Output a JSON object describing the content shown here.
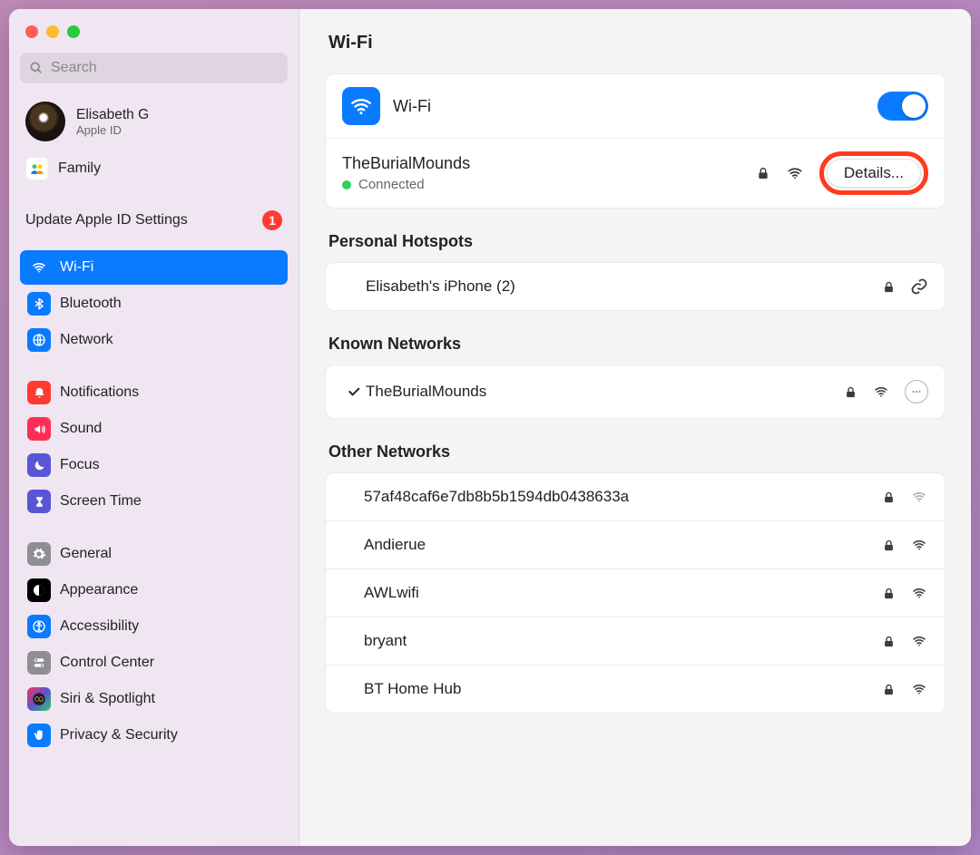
{
  "page_title": "Wi-Fi",
  "search": {
    "placeholder": "Search"
  },
  "user": {
    "name": "Elisabeth G",
    "subtitle": "Apple ID"
  },
  "family_label": "Family",
  "update_row": {
    "label": "Update Apple ID Settings",
    "badge": "1"
  },
  "sidebar": {
    "groups": [
      [
        {
          "id": "wifi",
          "label": "Wi-Fi",
          "selected": true,
          "icon": "wifi-icon",
          "tile": "#0a7aff"
        },
        {
          "id": "bluetooth",
          "label": "Bluetooth",
          "icon": "bluetooth-icon",
          "tile": "#0a7aff"
        },
        {
          "id": "network",
          "label": "Network",
          "icon": "globe-icon",
          "tile": "#0a7aff"
        }
      ],
      [
        {
          "id": "notifications",
          "label": "Notifications",
          "icon": "bell-icon",
          "tile": "#ff3b30"
        },
        {
          "id": "sound",
          "label": "Sound",
          "icon": "speaker-icon",
          "tile": "#ff2d55"
        },
        {
          "id": "focus",
          "label": "Focus",
          "icon": "moon-icon",
          "tile": "#5856d6"
        },
        {
          "id": "screen-time",
          "label": "Screen Time",
          "icon": "hourglass-icon",
          "tile": "#5856d6"
        }
      ],
      [
        {
          "id": "general",
          "label": "General",
          "icon": "gear-icon",
          "tile": "#8e8e93"
        },
        {
          "id": "appearance",
          "label": "Appearance",
          "icon": "appearance-icon",
          "tile": "#000000"
        },
        {
          "id": "accessibility",
          "label": "Accessibility",
          "icon": "accessibility-icon",
          "tile": "#0a7aff"
        },
        {
          "id": "control-center",
          "label": "Control Center",
          "icon": "switches-icon",
          "tile": "#8e8e93"
        },
        {
          "id": "siri",
          "label": "Siri & Spotlight",
          "icon": "siri-icon",
          "tile": "linear-gradient(135deg,#ff2d55,#5856d6,#34c759)"
        },
        {
          "id": "privacy",
          "label": "Privacy & Security",
          "icon": "hand-icon",
          "tile": "#0a7aff"
        }
      ]
    ]
  },
  "wifi_card": {
    "title": "Wi-Fi",
    "enabled": true,
    "connected": {
      "ssid": "TheBurialMounds",
      "status": "Connected",
      "secure": true
    },
    "details_label": "Details..."
  },
  "personal_hotspots": {
    "heading": "Personal Hotspots",
    "items": [
      {
        "name": "Elisabeth's iPhone (2)",
        "secure": true
      }
    ]
  },
  "known_networks": {
    "heading": "Known Networks",
    "items": [
      {
        "name": "TheBurialMounds",
        "checked": true,
        "secure": true
      }
    ]
  },
  "other_networks": {
    "heading": "Other Networks",
    "items": [
      {
        "name": "57af48caf6e7db8b5b1594db0438633a",
        "secure": true
      },
      {
        "name": "Andierue",
        "secure": true
      },
      {
        "name": "AWLwifi",
        "secure": true
      },
      {
        "name": "bryant",
        "secure": true
      },
      {
        "name": "BT Home Hub",
        "secure": true
      }
    ]
  }
}
